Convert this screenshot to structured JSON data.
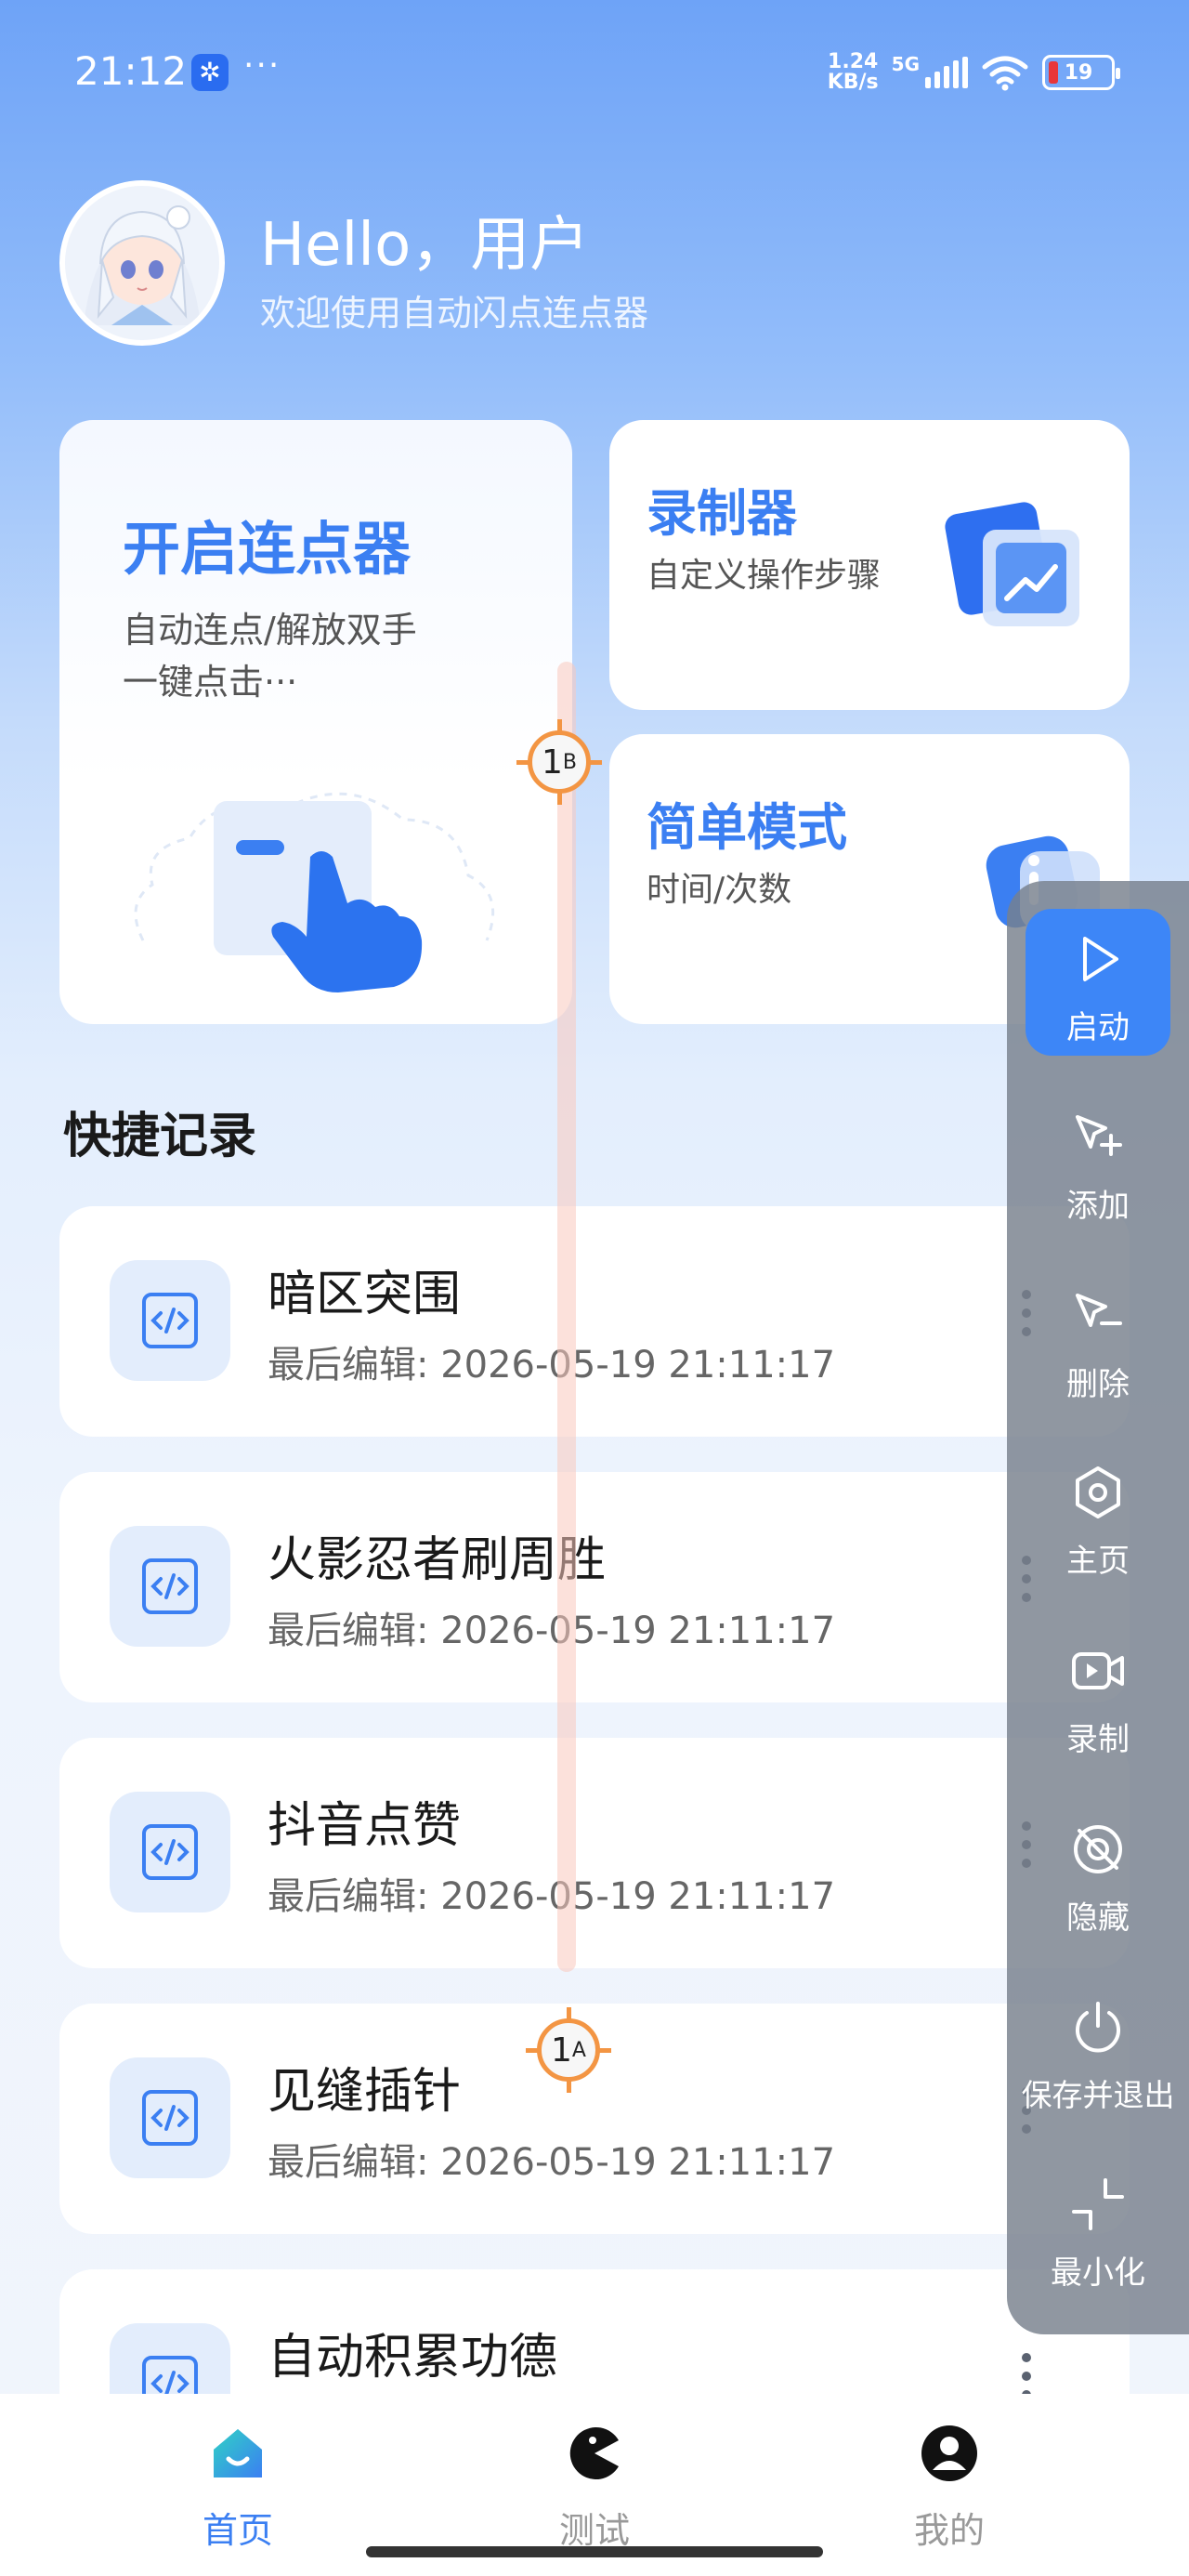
{
  "status_bar": {
    "time": "21:12",
    "dots": "···",
    "net_speed_value": "1.24",
    "net_speed_unit": "KB/s",
    "network": "5G",
    "battery": "19",
    "app_icon": "assistant-app-icon"
  },
  "header": {
    "greeting": "Hello，用户",
    "subtitle": "欢迎使用自动闪点连点器"
  },
  "cards": {
    "main": {
      "title": "开启连点器",
      "desc_line1": "自动连点/解放双手",
      "desc_line2": "一键点击···"
    },
    "recorder": {
      "title": "录制器",
      "desc": "自定义操作步骤"
    },
    "simple": {
      "title": "简单模式",
      "desc": "时间/次数"
    }
  },
  "section": {
    "title": "快捷记录"
  },
  "records": [
    {
      "name": "暗区突围",
      "date": "最后编辑: 2026-05-19 21:11:17"
    },
    {
      "name": "火影忍者刷周胜",
      "date": "最后编辑: 2026-05-19 21:11:17"
    },
    {
      "name": "抖音点赞",
      "date": "最后编辑: 2026-05-19 21:11:17"
    },
    {
      "name": "见缝插针",
      "date": "最后编辑: 2026-05-19 21:11:17"
    },
    {
      "name": "自动积累功德",
      "date": ""
    }
  ],
  "targets": {
    "b": {
      "num": "1",
      "sup": "B"
    },
    "a": {
      "num": "1",
      "sup": "A"
    }
  },
  "toolbar": {
    "start": "启动",
    "add": "添加",
    "delete": "删除",
    "home": "主页",
    "record": "录制",
    "hide": "隐藏",
    "save_exit": "保存并退出",
    "minimize": "最小化"
  },
  "bottom_nav": {
    "home": "首页",
    "test": "测试",
    "mine": "我的"
  },
  "colors": {
    "accent": "#3b7ff2",
    "toolbar_bg": "#7a808c",
    "target_orange": "#f39543"
  }
}
